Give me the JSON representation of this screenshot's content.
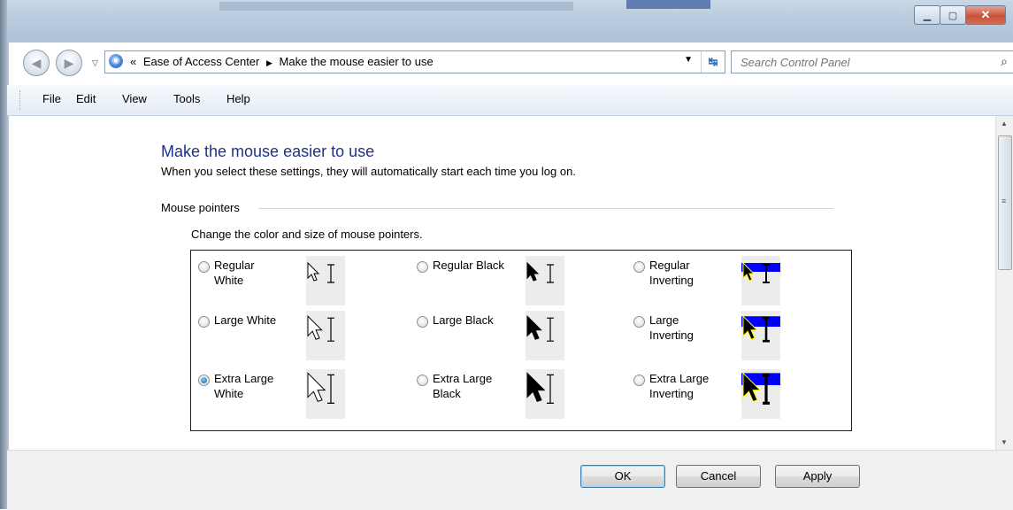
{
  "window": {
    "minimize_icon": "minimize-icon",
    "maximize_icon": "maximize-icon",
    "close_icon": "close-icon"
  },
  "address_bar": {
    "prefix": "«",
    "breadcrumbs": [
      "Ease of Access Center",
      "Make the mouse easier to use"
    ],
    "search_placeholder": "Search Control Panel"
  },
  "menu": [
    "File",
    "Edit",
    "View",
    "Tools",
    "Help"
  ],
  "page": {
    "title": "Make the mouse easier to use",
    "subtitle": "When you select these settings, they will automatically start each time you log on.",
    "section": "Mouse pointers",
    "description": "Change the color and size of mouse pointers.",
    "options": [
      {
        "line1": "Regular",
        "line2": "White",
        "checked": false,
        "scheme": "white"
      },
      {
        "line1": "Regular Black",
        "line2": "",
        "checked": false,
        "scheme": "black"
      },
      {
        "line1": "Regular",
        "line2": "Inverting",
        "checked": false,
        "scheme": "inverting"
      },
      {
        "line1": "Large White",
        "line2": "",
        "checked": false,
        "scheme": "white"
      },
      {
        "line1": "Large Black",
        "line2": "",
        "checked": false,
        "scheme": "black"
      },
      {
        "line1": "Large",
        "line2": "Inverting",
        "checked": false,
        "scheme": "inverting"
      },
      {
        "line1": "Extra Large",
        "line2": "White",
        "checked": true,
        "scheme": "white"
      },
      {
        "line1": "Extra Large",
        "line2": "Black",
        "checked": false,
        "scheme": "black"
      },
      {
        "line1": "Extra Large",
        "line2": "Inverting",
        "checked": false,
        "scheme": "inverting"
      }
    ]
  },
  "buttons": {
    "ok": "OK",
    "cancel": "Cancel",
    "apply": "Apply"
  },
  "colors": {
    "title": "#1e3287",
    "inverting_blue": "#0000ff",
    "inverting_yellow": "#ffff00"
  }
}
